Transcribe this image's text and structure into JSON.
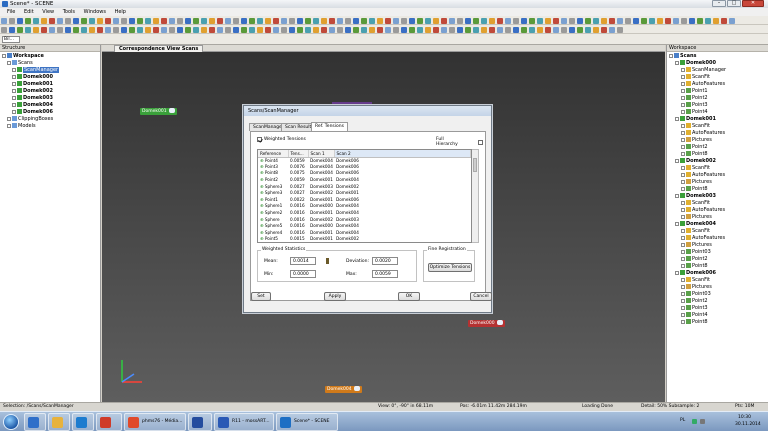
{
  "window": {
    "title": "Scene* - SCENE",
    "minimize": "–",
    "maximize": "□",
    "close": "✕"
  },
  "menu": [
    "File",
    "Edit",
    "View",
    "Tools",
    "Windows",
    "Help"
  ],
  "combo": {
    "value": "Bil..."
  },
  "structure_panel": {
    "title": "Structure",
    "items": [
      {
        "label": "Workspace",
        "bold": true,
        "level": 0
      },
      {
        "label": "Scans",
        "bold": false,
        "level": 1
      },
      {
        "label": "ScanManager",
        "bold": false,
        "level": 2,
        "selected": true
      },
      {
        "label": "Domek000",
        "bold": true,
        "level": 2
      },
      {
        "label": "Domek001",
        "bold": true,
        "level": 2
      },
      {
        "label": "Domek002",
        "bold": true,
        "level": 2
      },
      {
        "label": "Domek003",
        "bold": true,
        "level": 2
      },
      {
        "label": "Domek004",
        "bold": true,
        "level": 2
      },
      {
        "label": "Domek006",
        "bold": true,
        "level": 2
      },
      {
        "label": "ClippingBoxes",
        "bold": false,
        "level": 1
      },
      {
        "label": "Models",
        "bold": false,
        "level": 1
      }
    ]
  },
  "view_tab": {
    "label": "Correspondence View Scans"
  },
  "scan_labels": [
    {
      "label": "Domek001",
      "color": "#3aa03a"
    },
    {
      "label": "Domek000",
      "color": "#b43232"
    },
    {
      "label": "Domek004",
      "color": "#d07a1a"
    }
  ],
  "dialog": {
    "title": "Scans/ScanManager",
    "tabs": [
      "ScanManager",
      "Scan Results",
      "Ref. Tensions"
    ],
    "active_tab": "Ref. Tensions",
    "weighted_tensions_label": "Weighted Tensions",
    "full_hierarchy_label": "Full Hierarchy",
    "columns": [
      "Reference",
      "Tens...",
      "Scan 1",
      "Scan 2"
    ],
    "rows": [
      [
        "Point4",
        "0.0059",
        "Domek004",
        "Domek006"
      ],
      [
        "Point3",
        "0.0076",
        "Domek004",
        "Domek006"
      ],
      [
        "Point8",
        "0.0075",
        "Domek004",
        "Domek006"
      ],
      [
        "Point2",
        "0.0059",
        "Domek001",
        "Domek004"
      ],
      [
        "Sphere3",
        "0.0027",
        "Domek003",
        "Domek002"
      ],
      [
        "Sphere3",
        "0.0027",
        "Domek002",
        "Domek001"
      ],
      [
        "Point1",
        "0.0022",
        "Domek001",
        "Domek006"
      ],
      [
        "Sphere1",
        "0.0016",
        "Domek000",
        "Domek004"
      ],
      [
        "Sphere2",
        "0.0016",
        "Domek001",
        "Domek004"
      ],
      [
        "Sphere",
        "0.0016",
        "Domek002",
        "Domek003"
      ],
      [
        "Sphere5",
        "0.0016",
        "Domek000",
        "Domek004"
      ],
      [
        "Sphere4",
        "0.0016",
        "Domek001",
        "Domek004"
      ],
      [
        "Point5",
        "0.0015",
        "Domek001",
        "Domek002"
      ]
    ],
    "weighted_statistics": {
      "title": "Weighted Statistics",
      "mean_label": "Mean:",
      "mean": "0.0014",
      "deviation_label": "Deviation:",
      "deviation": "0.0020",
      "min_label": "Min:",
      "min": "0.0000",
      "max_label": "Max:",
      "max": "0.0059"
    },
    "fine_registration": {
      "title": "Fine Registration",
      "button": "Optimize Tensions"
    },
    "buttons": {
      "set": "Set",
      "apply": "Apply",
      "ok": "OK",
      "cancel": "Cancel"
    }
  },
  "workspace_panel": {
    "title": "Workspace",
    "root": "Scans",
    "groups": [
      {
        "name": "Domek000",
        "items": [
          "ScanManager",
          "ScanFit",
          "AutoFeatures",
          "Point1",
          "Point2",
          "Point3",
          "Point4"
        ]
      },
      {
        "name": "Domek001",
        "items": [
          "ScanFit",
          "AutoFeatures",
          "Pictures",
          "Point2",
          "Point8"
        ]
      },
      {
        "name": "Domek002",
        "items": [
          "ScanFit",
          "AutoFeatures",
          "Pictures",
          "Point8"
        ]
      },
      {
        "name": "Domek003",
        "items": [
          "ScanFit",
          "AutoFeatures",
          "Pictures"
        ]
      },
      {
        "name": "Domek004",
        "items": [
          "ScanFit",
          "AutoFeatures",
          "Pictures",
          "Point03",
          "Point2",
          "Point8"
        ]
      },
      {
        "name": "Domek006",
        "items": [
          "ScanFit",
          "Pictures",
          "Point03",
          "Point2",
          "Point3",
          "Point4",
          "Point8"
        ]
      }
    ]
  },
  "statusbar": {
    "selection": "Selection: /Scans/ScanManager",
    "view": "View: 0°, -90° in 68.11m",
    "pos": "Pos: -6.01m 11.42m 284.19m",
    "loading": "Loading Done",
    "detail": "Detail: 50%  Subsample: 2",
    "fps": "Pts: 10M"
  },
  "taskbar": {
    "buttons": [
      {
        "label": "",
        "color": "#2f6fc9"
      },
      {
        "label": "",
        "color": "#e7b23c"
      },
      {
        "label": "",
        "color": "#1d7ccf"
      },
      {
        "label": "",
        "color": "#cf3b2a"
      },
      {
        "label": "phms76 - Média...",
        "color": "#e04a2b"
      },
      {
        "label": "",
        "color": "#244c9e"
      },
      {
        "label": "R11 - mossART...",
        "color": "#2a59b5"
      },
      {
        "label": "Scene* - SCENE",
        "color": "#1e6fc4"
      }
    ],
    "lang": "PL",
    "time": "10:30",
    "date": "30.11.2014"
  },
  "colors": {
    "accent": "#3e74c4",
    "viewport_top": "#323232",
    "viewport_bottom": "#5e5e5e"
  }
}
